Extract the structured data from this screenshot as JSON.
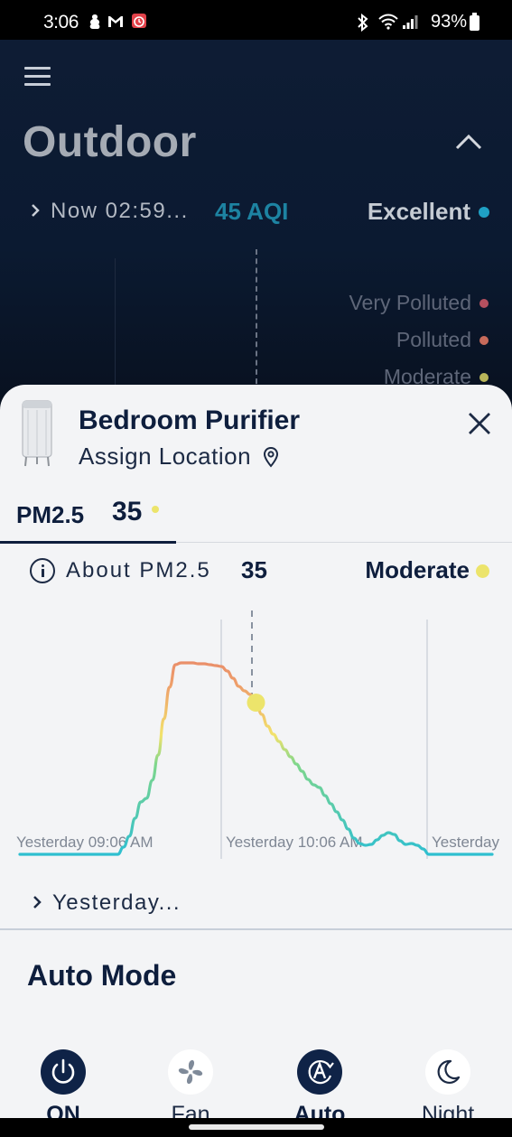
{
  "status_bar": {
    "time": "3:06",
    "battery": "93%"
  },
  "outdoor": {
    "title": "Outdoor",
    "now_label": "Now 02:59...",
    "aqi": "45 AQI",
    "rating": "Excellent",
    "rating_color": "#1fa0c4",
    "legend": [
      {
        "label": "Very Polluted",
        "color": "#b5505f"
      },
      {
        "label": "Polluted",
        "color": "#c76b5b"
      },
      {
        "label": "Moderate",
        "color": "#b9b65a"
      }
    ]
  },
  "device": {
    "name": "Bedroom Purifier",
    "assign_location": "Assign Location"
  },
  "tab": {
    "label": "PM2.5",
    "value": "35"
  },
  "about": {
    "label": "About PM2.5",
    "value": "35",
    "rating": "Moderate",
    "rating_color": "#ece46b"
  },
  "chart_data": {
    "type": "line",
    "x_labels": [
      "Yesterday 09:06 AM",
      "Yesterday 10:06 AM",
      "Yesterday"
    ],
    "series": [
      {
        "values": [
          0,
          0,
          0,
          0,
          0,
          0,
          0,
          0,
          0,
          0,
          0,
          0,
          0,
          0,
          0,
          0,
          0,
          0,
          8,
          20,
          40,
          58,
          62,
          82,
          110,
          150,
          185,
          210,
          212,
          212,
          212,
          211,
          211,
          210,
          209,
          208,
          203,
          195,
          186,
          181,
          177,
          168,
          155,
          142,
          133,
          125,
          116,
          108,
          100,
          92,
          83,
          77,
          74,
          65,
          56,
          47,
          38,
          28,
          18,
          12,
          10,
          11,
          16,
          21,
          24,
          22,
          15,
          11,
          12,
          10,
          6,
          0,
          0,
          0,
          0,
          0,
          0,
          0,
          0,
          0,
          0,
          0,
          0
        ]
      }
    ],
    "highlight_index": 41,
    "highlight_color": "#ece46b"
  },
  "range_label": "Yesterday...",
  "mode_title": "Auto Mode",
  "controls": [
    {
      "label": "ON",
      "icon": "power-icon",
      "active": true
    },
    {
      "label": "Fan speed",
      "icon": "fan-icon",
      "active": false
    },
    {
      "label": "Auto",
      "icon": "auto-icon",
      "active": true
    },
    {
      "label": "Night",
      "icon": "moon-icon",
      "active": false
    }
  ],
  "colors": {
    "navy": "#0e1e3d",
    "active_circle": "#0f2347",
    "line_low": "#2fbfd0",
    "line_mid": "#f2e26b",
    "line_high": "#e88a6a"
  }
}
